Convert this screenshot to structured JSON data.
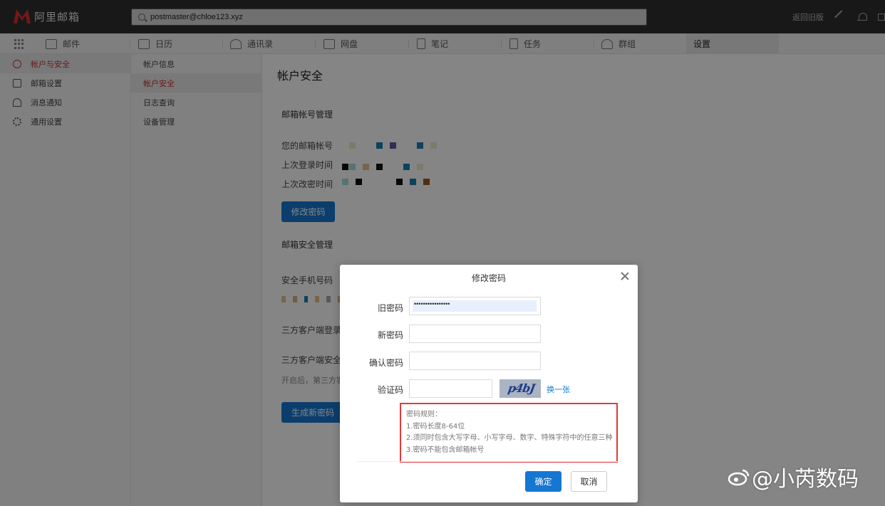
{
  "app": {
    "logo_text": "阿里邮箱",
    "brand_color": "#d9302c"
  },
  "search": {
    "value": "postmaster@chloe123.xyz"
  },
  "topbar": {
    "back_old": "返回旧版"
  },
  "nav": {
    "items": [
      {
        "label": "邮件",
        "icon": "mail-icon"
      },
      {
        "label": "日历",
        "icon": "calendar-icon"
      },
      {
        "label": "通讯录",
        "icon": "contacts-icon"
      },
      {
        "label": "网盘",
        "icon": "drive-icon"
      },
      {
        "label": "笔记",
        "icon": "note-icon"
      },
      {
        "label": "任务",
        "icon": "task-icon"
      },
      {
        "label": "群组",
        "icon": "group-icon"
      },
      {
        "label": "设置",
        "icon": ""
      }
    ]
  },
  "sidebar": {
    "items": [
      {
        "label": "帐户与安全",
        "icon": "user-circle-icon"
      },
      {
        "label": "邮箱设置",
        "icon": "mail-settings-icon"
      },
      {
        "label": "消息通知",
        "icon": "bell-icon"
      },
      {
        "label": "通用设置",
        "icon": "gear-icon"
      }
    ]
  },
  "subnav": {
    "items": [
      {
        "label": "帐户信息"
      },
      {
        "label": "帐户安全"
      },
      {
        "label": "日志查询"
      },
      {
        "label": "设备管理"
      }
    ]
  },
  "main": {
    "title": "帐户安全",
    "mailbox_mgmt": "邮箱帐号管理",
    "your_account": "您的邮箱帐号",
    "last_login": "上次登录时间",
    "last_pwd_change": "上次改密时间",
    "change_pwd_btn": "修改密码",
    "security_mgmt": "邮箱安全管理",
    "phone": "安全手机号码",
    "third_party_login": "三方客户端登录",
    "third_party_security": "三方客户端安全",
    "enabled_note": "开启后，第三方客",
    "gen_pwd_btn": "生成新密码"
  },
  "dialog": {
    "title": "修改密码",
    "old_pwd_label": "旧密码",
    "old_pwd_value": "••••••••••••••••",
    "new_pwd_label": "新密码",
    "confirm_pwd_label": "确认密码",
    "captcha_label": "验证码",
    "captcha_text": "p4bJ",
    "refresh": "换一张",
    "rules": [
      "密码规则：",
      "1.密码长度8-64位",
      "2.须同时包含大写字母、小写字母、数字、特殊字符中的任意三种",
      "3.密码不能包含邮箱帐号"
    ],
    "ok": "确定",
    "cancel": "取消"
  },
  "watermark": {
    "text": "@小芮数码"
  }
}
